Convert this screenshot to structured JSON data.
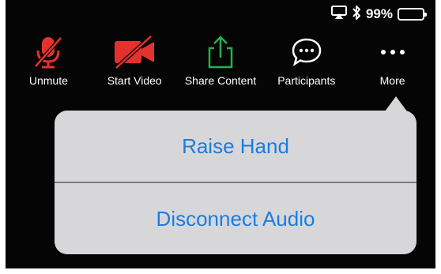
{
  "status": {
    "battery_percent": "99%",
    "battery_level": 0.99,
    "icons": [
      "airplay-icon",
      "bluetooth-icon",
      "battery-icon"
    ]
  },
  "toolbar": {
    "unmute_label": "Unmute",
    "start_video_label": "Start Video",
    "share_content_label": "Share Content",
    "participants_label": "Participants",
    "more_label": "More"
  },
  "more_menu": {
    "raise_hand": "Raise Hand",
    "disconnect_audio": "Disconnect Audio"
  },
  "colors": {
    "muted_red": "#e5312e",
    "share_green": "#23b14d",
    "menu_text_blue": "#1a7de0",
    "menu_background": "#d7d7da",
    "toolbar_background": "#050505"
  }
}
